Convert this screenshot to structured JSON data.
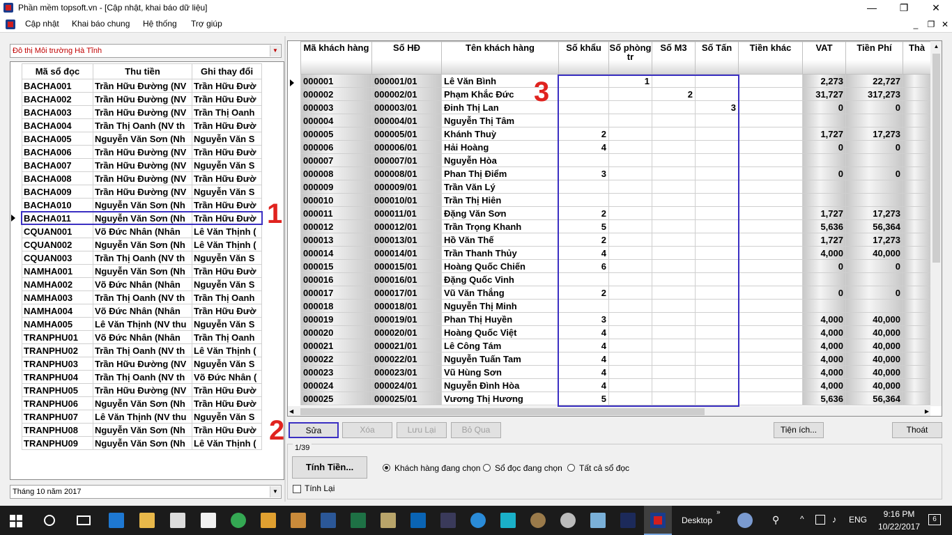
{
  "window": {
    "title": "Phần mềm topsoft.vn - [Cập nhật, khai báo dữ liệu]",
    "minimize": "—",
    "restore": "❐",
    "close": "✕"
  },
  "menu": {
    "items": [
      "Cập nhật",
      "Khai báo chung",
      "Hệ thống",
      "Trợ giúp"
    ],
    "mdi_min": "_",
    "mdi_restore": "❐",
    "mdi_close": "✕"
  },
  "area_select": {
    "value": "Đô thị Môi trường Hà Tĩnh"
  },
  "left_grid": {
    "columns": [
      "Mã sổ đọc",
      "Thu tiền",
      "Ghi thay đổi"
    ],
    "rows": [
      [
        "BACHA001",
        "Trần Hữu Đường (NV",
        "Trần Hữu Đườ"
      ],
      [
        "BACHA002",
        "Trần Hữu Đường (NV",
        "Trần Hữu Đườ"
      ],
      [
        "BACHA003",
        "Trần Hữu Đường (NV",
        "Trần Thị Oanh"
      ],
      [
        "BACHA004",
        "Trần Thị Oanh (NV th",
        "Trần Hữu Đườ"
      ],
      [
        "BACHA005",
        "Nguyễn Văn Sơn (Nh",
        "Nguyễn Văn S"
      ],
      [
        "BACHA006",
        "Trần Hữu Đường (NV",
        "Trần Hữu Đườ"
      ],
      [
        "BACHA007",
        "Trần Hữu Đường (NV",
        "Nguyễn Văn S"
      ],
      [
        "BACHA008",
        "Trần Hữu Đường (NV",
        "Trần Hữu Đườ"
      ],
      [
        "BACHA009",
        "Trần Hữu Đường (NV",
        "Nguyễn Văn S"
      ],
      [
        "BACHA010",
        "Nguyễn Văn Sơn (Nh",
        "Trần Hữu Đườ"
      ],
      [
        "BACHA011",
        "Nguyễn Văn Sơn (Nh",
        "Trần Hữu Đườ"
      ],
      [
        "CQUAN001",
        "Võ Đức Nhân (Nhân",
        "Lê Văn Thịnh ("
      ],
      [
        "CQUAN002",
        "Nguyễn Văn Sơn (Nh",
        "Lê Văn Thịnh ("
      ],
      [
        "CQUAN003",
        "Trần Thị Oanh (NV th",
        "Nguyễn Văn S"
      ],
      [
        "NAMHA001",
        "Nguyễn Văn Sơn (Nh",
        "Trần Hữu Đườ"
      ],
      [
        "NAMHA002",
        "Võ Đức Nhân (Nhân",
        "Nguyễn Văn S"
      ],
      [
        "NAMHA003",
        "Trần Thị Oanh (NV th",
        "Trần Thị Oanh"
      ],
      [
        "NAMHA004",
        "Võ Đức Nhân (Nhân",
        "Trần Hữu Đườ"
      ],
      [
        "NAMHA005",
        "Lê Văn Thịnh (NV thu",
        "Nguyễn Văn S"
      ],
      [
        "TRANPHU01",
        "Võ Đức Nhân (Nhân",
        "Trần Thị Oanh"
      ],
      [
        "TRANPHU02",
        "Trần Thị Oanh (NV th",
        "Lê Văn Thịnh ("
      ],
      [
        "TRANPHU03",
        "Trần Hữu Đường (NV",
        "Nguyễn Văn S"
      ],
      [
        "TRANPHU04",
        "Trần Thị Oanh (NV th",
        "Võ Đức Nhân ("
      ],
      [
        "TRANPHU05",
        "Trần Hữu Đường (NV",
        "Trần Hữu Đườ"
      ],
      [
        "TRANPHU06",
        "Nguyễn Văn Sơn (Nh",
        "Trần Hữu Đườ"
      ],
      [
        "TRANPHU07",
        "Lê Văn Thịnh (NV thu",
        "Nguyễn Văn S"
      ],
      [
        "TRANPHU08",
        "Nguyễn Văn Sơn (Nh",
        "Trần Hữu Đườ"
      ],
      [
        "TRANPHU09",
        "Nguyễn Văn Sơn (Nh",
        "Lê Văn Thịnh ("
      ]
    ]
  },
  "month_select": {
    "value": "Tháng 10 năm 2017"
  },
  "right_grid": {
    "columns": [
      "Mã khách hàng",
      "Số HĐ",
      "Tên khách hàng",
      "Số khẩu",
      "Số phòng tr",
      "Số M3",
      "Số Tấn",
      "Tiền khác",
      "VAT",
      "Tiền Phí",
      "Thà"
    ],
    "rows": [
      [
        "000001",
        "000001/01",
        "Lê Văn Bình",
        "",
        "1",
        "",
        "",
        "",
        "2,273",
        "22,727"
      ],
      [
        "000002",
        "000002/01",
        "Phạm Khắc Đức",
        "",
        "",
        "2",
        "",
        "",
        "31,727",
        "317,273"
      ],
      [
        "000003",
        "000003/01",
        "Đinh Thị Lan",
        "",
        "",
        "",
        "3",
        "",
        "0",
        "0"
      ],
      [
        "000004",
        "000004/01",
        "Nguyễn Thị Tâm",
        "",
        "",
        "",
        "",
        "",
        "",
        ""
      ],
      [
        "000005",
        "000005/01",
        "Khánh Thuỳ",
        "2",
        "",
        "",
        "",
        "",
        "1,727",
        "17,273"
      ],
      [
        "000006",
        "000006/01",
        "Hải Hoàng",
        "4",
        "",
        "",
        "",
        "",
        "0",
        "0"
      ],
      [
        "000007",
        "000007/01",
        "Nguyễn Hòa",
        "",
        "",
        "",
        "",
        "",
        "",
        ""
      ],
      [
        "000008",
        "000008/01",
        "Phan Thị Điểm",
        "3",
        "",
        "",
        "",
        "",
        "0",
        "0"
      ],
      [
        "000009",
        "000009/01",
        "Trần Văn Lý",
        "",
        "",
        "",
        "",
        "",
        "",
        ""
      ],
      [
        "000010",
        "000010/01",
        "Trần Thị Hiên",
        "",
        "",
        "",
        "",
        "",
        "",
        ""
      ],
      [
        "000011",
        "000011/01",
        "Đặng Văn Sơn",
        "2",
        "",
        "",
        "",
        "",
        "1,727",
        "17,273"
      ],
      [
        "000012",
        "000012/01",
        " Trần Trọng Khanh",
        "5",
        "",
        "",
        "",
        "",
        "5,636",
        "56,364"
      ],
      [
        "000013",
        "000013/01",
        "Hồ Văn Thế",
        "2",
        "",
        "",
        "",
        "",
        "1,727",
        "17,273"
      ],
      [
        "000014",
        "000014/01",
        "Trần Thanh Thủy",
        "4",
        "",
        "",
        "",
        "",
        "4,000",
        "40,000"
      ],
      [
        "000015",
        "000015/01",
        "Hoàng Quốc Chiến",
        "6",
        "",
        "",
        "",
        "",
        "0",
        "0"
      ],
      [
        "000016",
        "000016/01",
        "Đặng Quốc Vinh",
        "",
        "",
        "",
        "",
        "",
        "",
        ""
      ],
      [
        "000017",
        "000017/01",
        "Vũ Văn Thắng",
        "2",
        "",
        "",
        "",
        "",
        "0",
        "0"
      ],
      [
        "000018",
        "000018/01",
        "Nguyễn Thị Minh",
        "",
        "",
        "",
        "",
        "",
        "",
        ""
      ],
      [
        "000019",
        "000019/01",
        "Phan Thị Huyền",
        "3",
        "",
        "",
        "",
        "",
        "4,000",
        "40,000"
      ],
      [
        "000020",
        "000020/01",
        "Hoàng Quốc  Việt",
        "4",
        "",
        "",
        "",
        "",
        "4,000",
        "40,000"
      ],
      [
        "000021",
        "000021/01",
        "Lê Công Tám",
        "4",
        "",
        "",
        "",
        "",
        "4,000",
        "40,000"
      ],
      [
        "000022",
        "000022/01",
        "Nguyễn Tuấn Tam",
        "4",
        "",
        "",
        "",
        "",
        "4,000",
        "40,000"
      ],
      [
        "000023",
        "000023/01",
        "Vũ Hùng Sơn",
        "4",
        "",
        "",
        "",
        "",
        "4,000",
        "40,000"
      ],
      [
        "000024",
        "000024/01",
        "Nguyễn Đình Hòa",
        "4",
        "",
        "",
        "",
        "",
        "4,000",
        "40,000"
      ],
      [
        "000025",
        "000025/01",
        "Vương  Thị Hương",
        "5",
        "",
        "",
        "",
        "",
        "5,636",
        "56,364"
      ]
    ]
  },
  "annotations": {
    "a1": "1",
    "a2": "2",
    "a3": "3"
  },
  "buttons": {
    "edit": "Sửa",
    "delete": "Xóa",
    "save": "Lưu Lại",
    "skip": "Bỏ Qua",
    "utilities": "Tiện ích...",
    "exit": "Thoát",
    "calculate": "Tính Tiền..."
  },
  "record_counter": "1/39",
  "calc_options": {
    "opt1": "Khách hàng đang chọn",
    "opt2": "Sổ đọc đang chọn",
    "opt3": "Tất cả sổ đọc",
    "selected": "opt1",
    "recalc": "Tính Lại"
  },
  "taskbar": {
    "desktop_label": "Desktop",
    "language": "ENG",
    "time": "9:16 PM",
    "date": "10/22/2017",
    "notifications": "6"
  }
}
